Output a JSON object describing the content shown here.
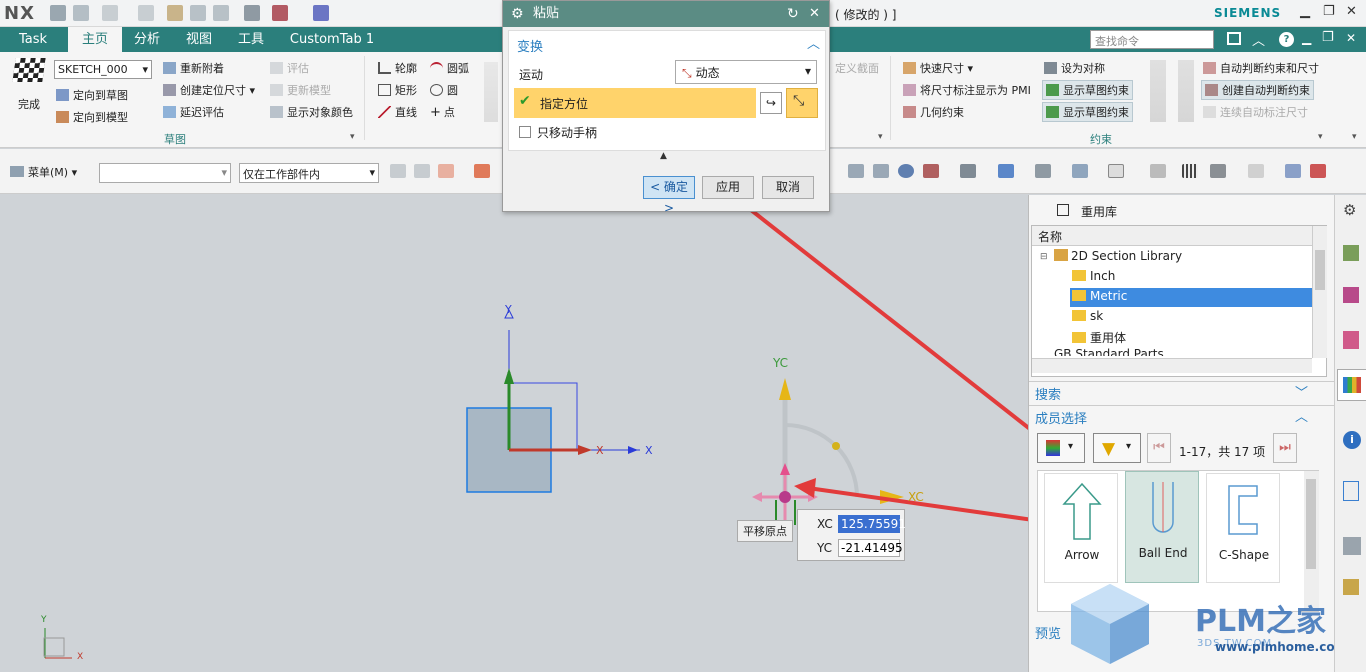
{
  "titlebar": {
    "logo": "NX",
    "title_suffix": "( 修改的 ) ]",
    "brand": "SIEMENS"
  },
  "tabs": [
    {
      "label": "Task"
    },
    {
      "label": "主页"
    },
    {
      "label": "分析"
    },
    {
      "label": "视图"
    },
    {
      "label": "工具"
    },
    {
      "label": "CustomTab 1"
    }
  ],
  "search": {
    "placeholder": "查找命令"
  },
  "ribbon": {
    "finish": "完成",
    "sketch_name": "SKETCH_000",
    "orient_sketch": "定向到草图",
    "orient_model": "定向到模型",
    "reattach": "重新附着",
    "create_pos_dim": "创建定位尺寸",
    "delay_eval": "延迟评估",
    "evaluate": "评估",
    "update_model": "更新模型",
    "show_obj_color": "显示对象颜色",
    "group_sketch": "草图",
    "profile": "轮廓",
    "arc": "圆弧",
    "rectangle": "矩形",
    "circle": "圆",
    "line": "直线",
    "point": "点",
    "custom_section": "定义截面",
    "quick_dim": "快速尺寸",
    "dim_to_pmi": "将尺寸标注显示为 PMI",
    "geo_constraint": "几何约束",
    "set_symmetric": "设为对称",
    "show_sketch_constraint": "显示草图约束",
    "show_sketch_constraint2": "显示草图约束",
    "auto_constraint_dim": "自动判断约束和尺寸",
    "create_auto_constraint": "创建自动判断约束",
    "continuous_auto_dim": "连续自动标注尺寸",
    "group_constraint": "约束"
  },
  "toolbar2": {
    "menu": "菜单(M)",
    "filter_value": "",
    "scope": "仅在工作部件内"
  },
  "dialog": {
    "title": "粘贴",
    "section": "变换",
    "motion_label": "运动",
    "motion_value": "动态",
    "specify_orientation": "指定方位",
    "move_handle_only": "只移动手柄",
    "ok": "< 确定 >",
    "apply": "应用",
    "cancel": "取消"
  },
  "canvas": {
    "x_label": "X",
    "y_label": "Y",
    "xc_label": "XC",
    "yc_label": "YC",
    "tooltip": "平移原点",
    "xc_field_label": "XC",
    "xc_value": "125.75591",
    "yc_field_label": "YC",
    "yc_value": "-21.41495",
    "wcs_x": "X",
    "wcs_y": "Y"
  },
  "reuse_library": {
    "title": "重用库",
    "column_name": "名称",
    "tree": [
      {
        "label": "2D Section Library"
      },
      {
        "label": "Inch"
      },
      {
        "label": "Metric"
      },
      {
        "label": "sk"
      },
      {
        "label": "重用体"
      },
      {
        "label": "GB Standard Parts"
      }
    ],
    "search": "搜索",
    "member_select": "成员选择",
    "count": "1-17，共 17 项",
    "members": [
      {
        "label": "Arrow"
      },
      {
        "label": "Ball End"
      },
      {
        "label": "C-Shape"
      }
    ],
    "preview": "预览"
  },
  "watermark": {
    "brand": "PLM之家",
    "url1": "3DS.TW.COM",
    "url2": "www.plmhome.com"
  },
  "colors": {
    "accent": "#2b7f7c",
    "dialog_header": "#5b8c84",
    "highlight_row": "#ffd36b",
    "arrow": "#e23b3b"
  }
}
